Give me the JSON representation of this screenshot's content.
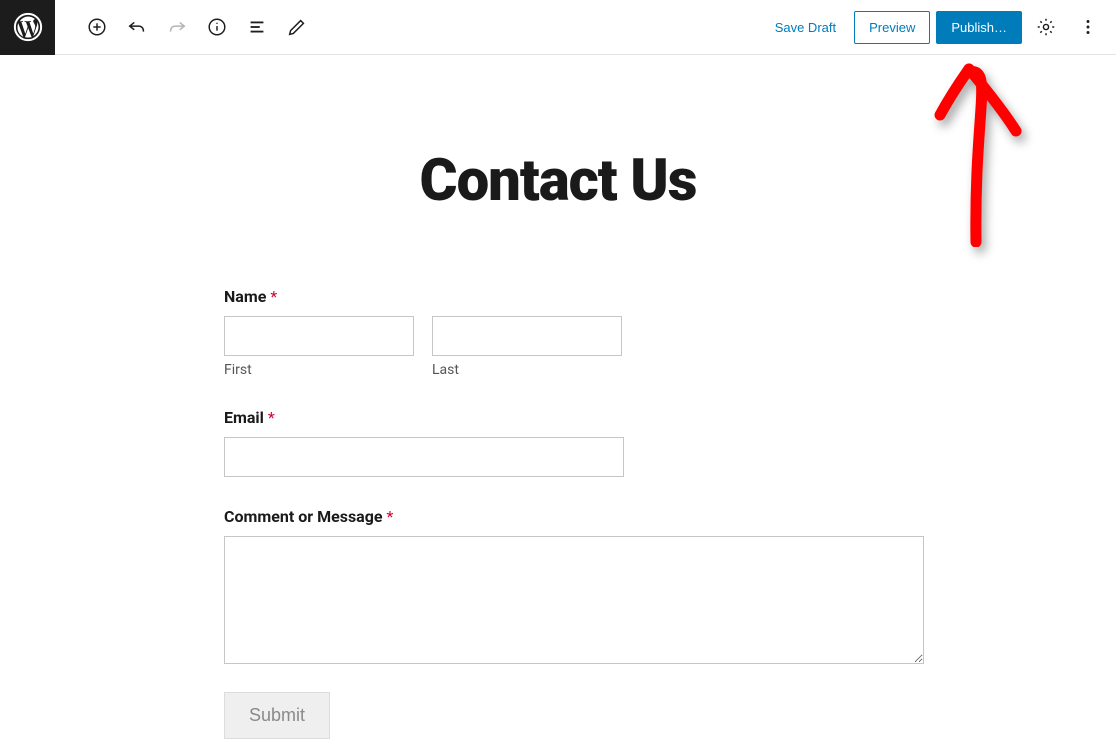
{
  "toolbar": {
    "save_draft": "Save Draft",
    "preview": "Preview",
    "publish": "Publish…"
  },
  "page": {
    "title": "Contact Us"
  },
  "form": {
    "name_label": "Name",
    "name_required": "*",
    "first_sub": "First",
    "last_sub": "Last",
    "email_label": "Email",
    "email_required": "*",
    "message_label": "Comment or Message",
    "message_required": "*",
    "submit": "Submit"
  }
}
